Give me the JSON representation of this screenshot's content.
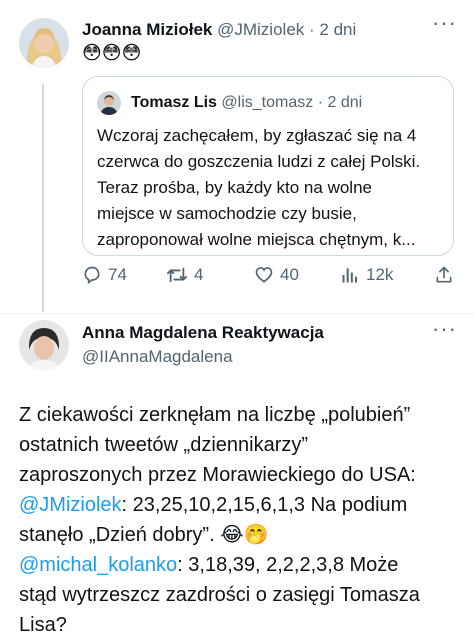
{
  "tweet1": {
    "name": "Joanna Miziołek",
    "handle": "@JMiziolek",
    "sep": "·",
    "time": "2 dni",
    "emojis": "😳😳😳"
  },
  "quote": {
    "name": "Tomasz Lis",
    "handle": "@lis_tomasz",
    "sep": "·",
    "time": "2 dni",
    "lines": [
      "Wczoraj zachęcałem, by zgłaszać się na 4",
      "czerwca do goszczenia ludzi z całej Polski.",
      "Teraz prośba, by każdy kto na wolne",
      "miejsce w samochodzie czy busie,",
      "zaproponował wolne miejsca chętnym, k..."
    ]
  },
  "actions": {
    "replies": "74",
    "retweets": "4",
    "likes": "40",
    "views": "12k"
  },
  "tweet2": {
    "name": "Anna Magdalena Reaktywacja",
    "handle": "@IIAnnaMagdalena",
    "line1": "Z ciekawości zerknęłam  na liczbę „polubień”",
    "line2": "ostatnich tweetów „dziennikarzy”",
    "line3": "zaproszonych przez Morawieckiego do USA:",
    "mention1": "@JMiziolek",
    "line4_rest": ": 23,25,10,2,15,6,1,3 Na podium",
    "line5": "stanęło „Dzień dobry”. ",
    "line5_emoji": "😂🤭",
    "mention2": "@michal_kolanko",
    "line6_rest": ": 3,18,39, 2,2,2,3,8 Może",
    "line7": "stąd wytrzeszcz zazdrości o zasięgi Tomasza",
    "line8": "Lisa?"
  },
  "colors": {
    "text": "#0f1419",
    "muted": "#536471",
    "link": "#1d9bf0",
    "border": "#cfd9de"
  },
  "icons": [
    "more-icon",
    "reply-icon",
    "retweet-icon",
    "like-icon",
    "views-icon",
    "share-icon"
  ]
}
